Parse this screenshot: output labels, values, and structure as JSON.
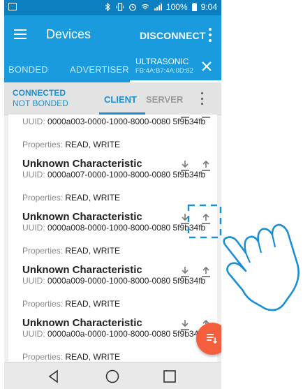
{
  "statusbar": {
    "battery": "100%",
    "time": "9:04"
  },
  "appbar": {
    "title": "Devices",
    "disconnect_label": "DISCONNECT"
  },
  "tabs": {
    "bonded": "BONDED",
    "advertiser": "ADVERTISER",
    "device_name": "ULTRASONIC",
    "device_address": "FB:4A:B7:4A:0D:82"
  },
  "connection": {
    "state": "CONNECTED",
    "bond": "NOT BONDED"
  },
  "subtabs": {
    "client": "CLIENT",
    "server": "SERVER"
  },
  "uuid_label": "UUID:",
  "props_label": "Properties:",
  "items": [
    {
      "name": "",
      "uuid": "0000a003-0000-1000-8000-0080 5f9b34fb",
      "props": "READ, WRITE"
    },
    {
      "name": "Unknown Characteristic",
      "uuid": "0000a007-0000-1000-8000-0080 5f9b34fb",
      "props": "READ, WRITE"
    },
    {
      "name": "Unknown Characteristic",
      "uuid": "0000a008-0000-1000-8000-0080 5f9b34fb",
      "props": "READ, WRITE"
    },
    {
      "name": "Unknown Characteristic",
      "uuid": "0000a009-0000-1000-8000-0080 5f9b34fb",
      "props": "READ, WRITE"
    },
    {
      "name": "Unknown Characteristic",
      "uuid": "0000a00a-0000-1000-8000-0080 5f9b34fb",
      "props": "READ, WRITE"
    }
  ],
  "icons": {
    "read": "download-icon",
    "write": "upload-icon",
    "fab": "sort-icon"
  },
  "colors": {
    "statusbar": "#0b7fbf",
    "appbar": "#1a9bde",
    "accent": "#1a8fd4",
    "fab": "#f55e3c",
    "gesture": "#1a8fd4"
  }
}
